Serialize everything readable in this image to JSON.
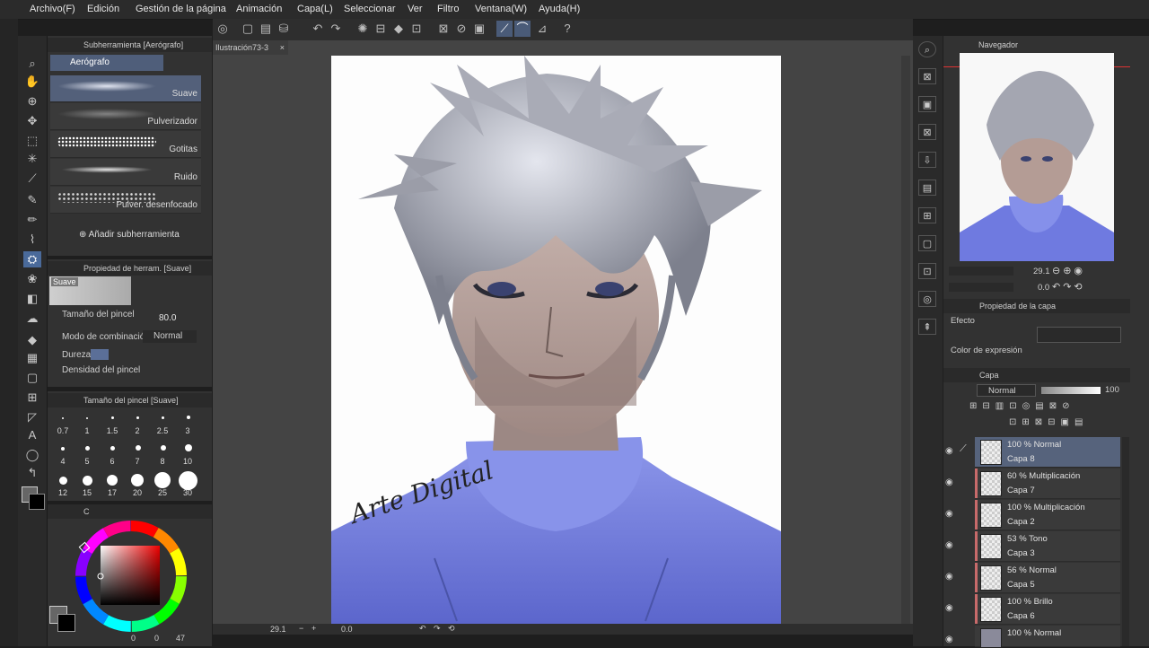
{
  "menu": [
    "Archivo(F)",
    "Edición",
    "Gestión de la página",
    "Animación",
    "Capa(L)",
    "Seleccionar",
    "Ver",
    "Filtro",
    "Ventana(W)",
    "Ayuda(H)"
  ],
  "subtool": {
    "header": "Subherramienta [Aerógrafo]",
    "group": "Aerógrafo",
    "items": [
      "Suave",
      "Pulverizador",
      "Gotitas",
      "Ruido",
      "Pulver. desenfocado"
    ],
    "add_label": "Añadir subherramienta"
  },
  "tool_property": {
    "header": "Propiedad de herram. [Suave]",
    "preview_name": "Suave",
    "brush_size_label": "Tamaño del pincel",
    "brush_size_value": "80.0",
    "blend_label": "Modo de combinación",
    "blend_value": "Normal",
    "hardness_label": "Dureza",
    "density_label": "Densidad del pincel"
  },
  "brush_size_panel": {
    "header": "Tamaño del pincel [Suave]",
    "sizes": [
      "0.7",
      "1",
      "1.5",
      "2",
      "2.5",
      "3",
      "4",
      "5",
      "6",
      "7",
      "8",
      "10",
      "12",
      "15",
      "17",
      "20",
      "25",
      "30"
    ]
  },
  "color": {
    "tab_c": "C",
    "hue_value": 0.95,
    "counter_a": "0",
    "counter_b": "0",
    "counter_c": "47"
  },
  "document": {
    "tab_label": "Ilustración73-3",
    "close": "×",
    "zoom": "29.1",
    "rotation": "0.0",
    "signature": "Arte Digital"
  },
  "navigator": {
    "header": "Navegador",
    "zoom": "29.1",
    "rotation": "0.0"
  },
  "layer_property": {
    "header": "Propiedad de la capa",
    "effect_label": "Efecto",
    "expression_label": "Color de expresión"
  },
  "layers_panel": {
    "tab": "Capa",
    "blend_mode": "Normal",
    "opacity": "100",
    "layers": [
      {
        "mode": "100 % Normal",
        "name": "Capa 8",
        "active": true
      },
      {
        "mode": "60 % Multiplicación",
        "name": "Capa 7"
      },
      {
        "mode": "100 % Multiplicación",
        "name": "Capa 2"
      },
      {
        "mode": "53 % Tono",
        "name": "Capa 3"
      },
      {
        "mode": "56 % Normal",
        "name": "Capa 5"
      },
      {
        "mode": "100 % Brillo",
        "name": "Capa 6"
      },
      {
        "mode": "100 % Normal",
        "name": ""
      }
    ]
  },
  "colors": {
    "accent": "#53607a",
    "sweater": "#7a86e6",
    "hair": "#a7a9b3",
    "skin": "#b49c95"
  }
}
